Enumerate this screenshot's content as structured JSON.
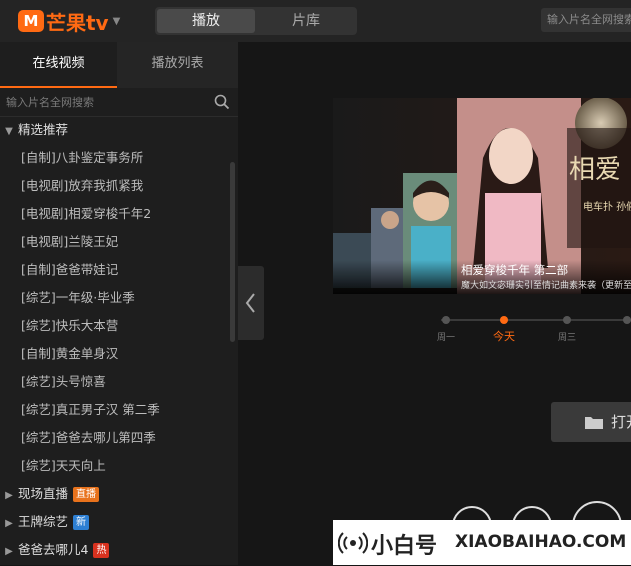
{
  "app": {
    "logo_text": "芒果tv",
    "logo_mark": "M"
  },
  "top_tabs": [
    "播放",
    "片库"
  ],
  "top_search_placeholder": "输入片名全网搜索",
  "sidebar": {
    "tabs": [
      "在线视频",
      "播放列表"
    ],
    "search_placeholder": "输入片名全网搜索",
    "groups": [
      {
        "label": "精选推荐",
        "expanded": true,
        "items": [
          "[自制]八卦鉴定事务所",
          "[电视剧]放弃我抓紧我",
          "[电视剧]相爱穿梭千年2",
          "[电视剧]兰陵王妃",
          "[自制]爸爸带娃记",
          "[综艺]一年级·毕业季",
          "[综艺]快乐大本营",
          "[自制]黄金单身汉",
          "[综艺]头号惊喜",
          "[综艺]真正男子汉 第二季",
          "[综艺]爸爸去哪儿第四季",
          "[综艺]天天向上"
        ]
      },
      {
        "label": "现场直播",
        "badge": "直播",
        "badge_color": "#e8721c"
      },
      {
        "label": "王牌综艺",
        "badge": "新",
        "badge_color": "#2d7fd3"
      },
      {
        "label": "爸爸去哪儿4",
        "badge": "热",
        "badge_color": "#d8321f"
      }
    ]
  },
  "hero": {
    "title": "相爱穿梭千年 第二部",
    "subtitle": "魔大如文宓珊实引至情记曲素来袭（更新至",
    "poster_text": "相爱",
    "poster_side": "电车扑 孙俪龙门"
  },
  "timeline": {
    "labels": [
      "周一",
      "今天",
      "周三"
    ],
    "active_index": 1
  },
  "open_button": {
    "label": "打开"
  },
  "watermark": {
    "cn": "小白号",
    "en": "XIAOBAIHAO.COM"
  },
  "colors": {
    "accent": "#ff6a13"
  }
}
